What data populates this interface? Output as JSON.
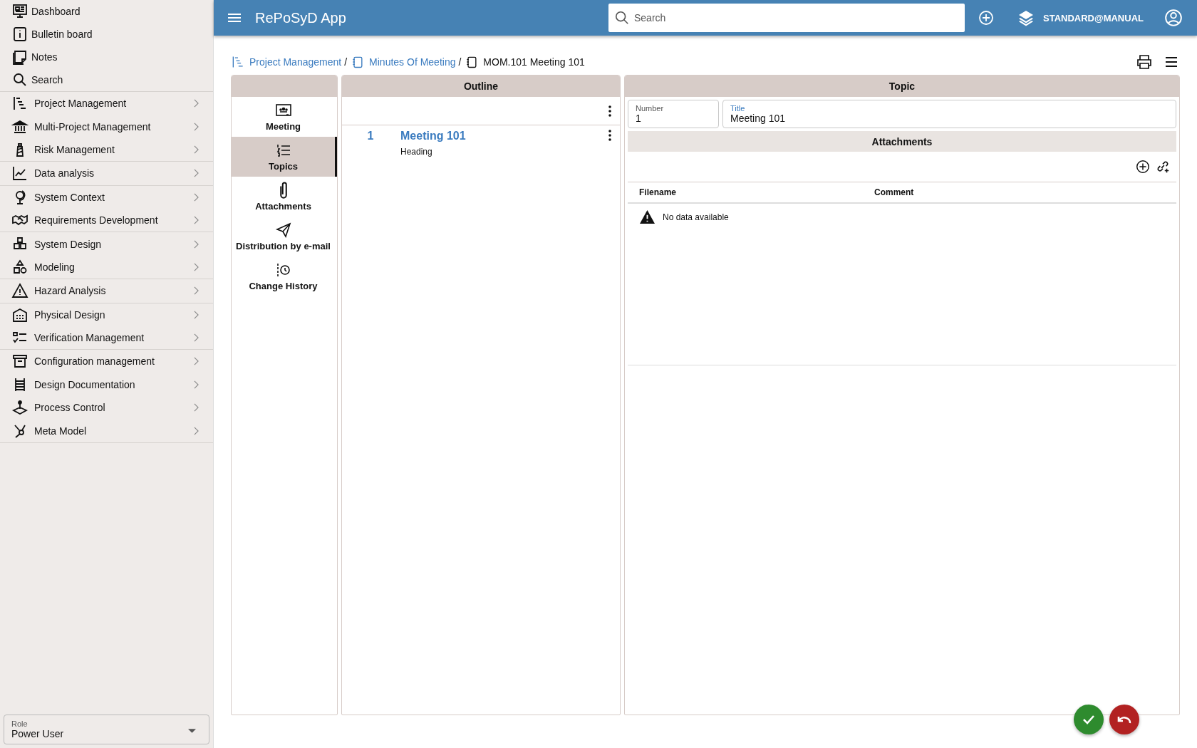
{
  "app_bar": {
    "title": "RePoSyD App",
    "search": {
      "placeholder": "Search"
    },
    "user": "STANDARD@MANUAL"
  },
  "sidebar": {
    "groups": [
      {
        "items": [
          {
            "label": "Dashboard",
            "kind": "link"
          },
          {
            "label": "Bulletin board",
            "kind": "link"
          },
          {
            "label": "Notes",
            "kind": "link"
          },
          {
            "label": "Search",
            "kind": "link"
          }
        ]
      },
      {
        "items": [
          {
            "label": "Project Management",
            "kind": "module"
          },
          {
            "label": "Multi-Project Management",
            "kind": "module"
          },
          {
            "label": "Risk Management",
            "kind": "module"
          }
        ]
      },
      {
        "items": [
          {
            "label": "Data analysis",
            "kind": "module"
          }
        ]
      },
      {
        "items": [
          {
            "label": "System Context",
            "kind": "module"
          },
          {
            "label": "Requirements Development",
            "kind": "module"
          }
        ]
      },
      {
        "items": [
          {
            "label": "System Design",
            "kind": "module"
          },
          {
            "label": "Modeling",
            "kind": "module"
          }
        ]
      },
      {
        "items": [
          {
            "label": "Hazard Analysis",
            "kind": "module"
          }
        ]
      },
      {
        "items": [
          {
            "label": "Physical Design",
            "kind": "module"
          },
          {
            "label": "Verification Management",
            "kind": "module"
          }
        ]
      },
      {
        "items": [
          {
            "label": "Configuration management",
            "kind": "module"
          },
          {
            "label": "Design Documentation",
            "kind": "module"
          },
          {
            "label": "Process Control",
            "kind": "module"
          },
          {
            "label": "Meta Model",
            "kind": "module"
          }
        ]
      }
    ],
    "role": {
      "label": "Role",
      "value": "Power User"
    }
  },
  "breadcrumb": {
    "separator": "/",
    "items": [
      {
        "label": "Project Management",
        "kind": "link"
      },
      {
        "label": "Minutes Of Meeting",
        "kind": "link"
      },
      {
        "label": "MOM.101 Meeting 101",
        "kind": "current"
      }
    ]
  },
  "tabs": [
    {
      "label": "Meeting",
      "selected": false
    },
    {
      "label": "Topics",
      "selected": true
    },
    {
      "label": "Attachments",
      "selected": false
    },
    {
      "label": "Distribution by e-mail",
      "selected": false
    },
    {
      "label": "Change History",
      "selected": false
    }
  ],
  "outline": {
    "title": "Outline",
    "items": [
      {
        "number": "1",
        "title": "Meeting 101",
        "subtitle": "Heading"
      }
    ]
  },
  "topic": {
    "title": "Topic",
    "fields": [
      {
        "label": "Number",
        "value": "1",
        "focused": false
      },
      {
        "label": "Title",
        "value": "Meeting 101",
        "focused": true
      }
    ],
    "attachments": {
      "title": "Attachments",
      "columns": [
        "Filename",
        "Comment"
      ],
      "empty_text": "No data available"
    }
  }
}
